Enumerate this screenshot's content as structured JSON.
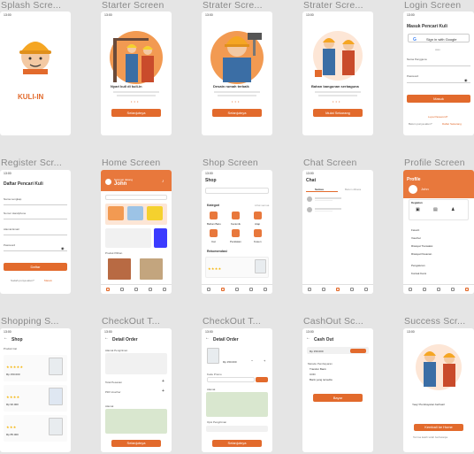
{
  "labels": {
    "splash": "Splash Scre...",
    "starter1": "Starter Screen",
    "starter2": "Strater Scre...",
    "starter3": "Strater Scre...",
    "login": "Login Screen",
    "register": "Register Scr...",
    "home": "Home Screen",
    "shop": "Shop Screen",
    "chat": "Chat Screen",
    "profile": "Profile Screen",
    "shopping": "Shopping S...",
    "checkout1": "CheckOut T...",
    "checkout2": "CheckOut T...",
    "cashout": "CashOut Sc...",
    "success": "Success Scr..."
  },
  "status_time": "13:00",
  "splash": {
    "brand": "KULI-IN"
  },
  "starter1": {
    "heading": "Nyari kuli di kuli-in",
    "button": "Selanjutnya"
  },
  "starter2": {
    "heading": "Desain rumah terbaik",
    "button": "Selanjutnya"
  },
  "starter3": {
    "heading": "Bahan bangunan serbaguna",
    "button": "Mulai Sekarang"
  },
  "login": {
    "title": "Masuk Pencari Kuli",
    "google": "Sign in with Google",
    "or": "atau",
    "user_label": "Nama Pengguna",
    "pass_label": "Password",
    "button": "Masuk",
    "forgot": "Lupa Password?",
    "register_text": "Belum punya akun?",
    "register_link": "Daftar Sekarang"
  },
  "register": {
    "title": "Daftar Pencari Kuli",
    "f1": "Nama Lengkap",
    "f2": "Nomor Handphone",
    "f3": "Alamat Email",
    "f4": "Password",
    "button": "Daftar",
    "login_text": "Sudah punya akun?",
    "login_link": "Masuk"
  },
  "home": {
    "greeting": "Selamat datang",
    "name": "John",
    "product_label": "Produk Pilihan"
  },
  "shop": {
    "title": "Shop",
    "cat": "Kategori",
    "cat_more": "Lihat semua",
    "c1": "Bahan Batu",
    "c2": "Keramik",
    "c3": "Atap",
    "c4": "Cat",
    "c5": "Peralatan",
    "c6": "Kusen",
    "best": "Rekomendasi"
  },
  "chat": {
    "title": "Chat",
    "tab1": "Semua",
    "tab2": "Belum dibaca"
  },
  "profile": {
    "title": "Profile",
    "name": "John",
    "section": "Kegiatan",
    "m1": "Favorit",
    "m2": "Voucher",
    "m3": "Riwayat Transaksi",
    "m4": "Riwayat Pesanan",
    "m5": "Pengaturan",
    "m6": "Kontak Kami"
  },
  "shopping": {
    "title": "Shop",
    "product": "Produk Cat",
    "price1": "Rp 150.000",
    "price2": "Rp 90.000",
    "price3": "Rp 85.000"
  },
  "checkout1": {
    "title": "Detail Order",
    "addr": "Alamat Pengiriman",
    "qty": "Total Pesanan",
    "note": "Pilih Voucher",
    "map": "Alamat",
    "button": "Selanjutnya"
  },
  "checkout2": {
    "title": "Detail Order",
    "price": "Rp 150.000",
    "promo": "Kode Promo",
    "map": "Alamat",
    "pay": "Opsi Pengiriman",
    "button": "Selanjutnya"
  },
  "cashout": {
    "title": "Cash Out",
    "amount": "Rp 150.000",
    "method": "Metode Pembayaran",
    "o1": "Transfer Bank",
    "o2": "COD",
    "o3": "Bank yang tersedia",
    "button": "Bayar"
  },
  "success": {
    "message": "Yeay! Pembayaran berhasil",
    "button": "Kembali ke Home",
    "note": "Terima kasih telah berbelanja"
  },
  "colors": {
    "accent": "#e26a2c",
    "bg": "#e5e5e5"
  }
}
